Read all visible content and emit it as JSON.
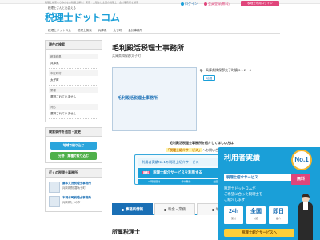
{
  "topbar": {
    "description": "税理士検索ならみんなの税理士探し！東京・大阪など全国の税理士・会計事務所を検索"
  },
  "logo": {
    "tagline": "税理士さんと出会える",
    "brand": "税理士ドットコム"
  },
  "header": {
    "login": "ログイン",
    "register": "会員登録(無料)",
    "tax_login": "税理士専用ログイン"
  },
  "breadcrumb": [
    "税理士ドットコム",
    "税理士検索",
    "兵庫県",
    "太子町",
    "会計事務所"
  ],
  "office": {
    "name": "毛利殿活税理士事務所",
    "location": "兵庫県揖保郡太子町",
    "address": "兵庫県揖保郡太子町鵤 3 1 2 − 6",
    "map_label": "地図"
  },
  "photo_text": "毛利殿活税理士事務所",
  "sidebar": {
    "current_conditions_title": "現在の検索",
    "conditions": [
      {
        "label": "都道府県",
        "value": "兵庫県"
      },
      {
        "label": "市区町村",
        "value": "太子町"
      },
      {
        "label": "業種",
        "value": "選択されていません"
      },
      {
        "label": "対応",
        "value": "選択されていません"
      }
    ],
    "search_title": "検索条件を追加・変更",
    "btn_area": "地域で絞り込む",
    "btn_category": "分野・業種で絞り込む",
    "nearby_title": "近くの税理士事務所",
    "nearby": [
      {
        "name": "藤本文茂税理士事務所",
        "addr": "兵庫県揖保郡太子町"
      },
      {
        "name": "本岡卓司税理士事務所",
        "addr": "兵庫県たつの市"
      }
    ]
  },
  "intro": {
    "line1": "毛利殿活税理士事務所を紹介してほしい方は",
    "line2_hl": "「税理士紹介サービス」",
    "line2_rest": "へお問い合わせください"
  },
  "service": {
    "row1": "利用者実績No.1の税理士紹介サービス",
    "badge": "無料",
    "row2": "税理士紹介サービスを利用する",
    "features": [
      "24時間受付",
      "年中無休",
      "全国対応",
      "最短即日紹介"
    ]
  },
  "tabs": [
    {
      "label": "事務所情報",
      "active": true
    },
    {
      "label": "料金・業務",
      "active": false
    },
    {
      "label": "地図",
      "active": false
    },
    {
      "label": "口コミ・評判",
      "active": false
    }
  ],
  "section": {
    "belonging": "所属税理士"
  },
  "ad": {
    "title": "利用者実績",
    "no1": "No.1",
    "sub": "税理士紹介サービス",
    "free": "無料",
    "text1": "税理士ドットコムが",
    "text2": "ご希望に合った税理士を",
    "text3": "ご紹介します",
    "stats": [
      {
        "big": "24h",
        "small": "受付"
      },
      {
        "big": "全国",
        "small": "対応"
      },
      {
        "big": "即日",
        "small": "紹介"
      }
    ],
    "button": "税理士紹介サービスへ"
  }
}
